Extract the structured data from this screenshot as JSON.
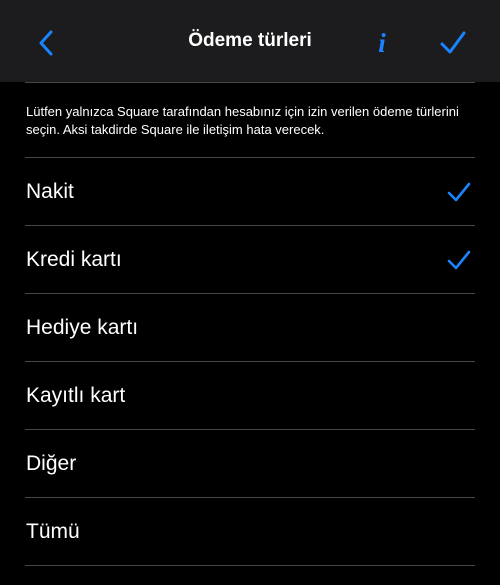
{
  "nav": {
    "title": "Ödeme türleri",
    "back_icon": "chevron-left-icon",
    "info_glyph": "i",
    "info_icon": "info-icon",
    "done_icon": "checkmark-icon"
  },
  "description": "Lütfen yalnızca Square tarafından hesabınız için izin verilen ödeme türlerini seçin. Aksi takdirde Square ile iletişim hata verecek.",
  "options": [
    {
      "label": "Nakit",
      "selected": true
    },
    {
      "label": "Kredi kartı",
      "selected": true
    },
    {
      "label": "Hediye kartı",
      "selected": false
    },
    {
      "label": "Kayıtlı kart",
      "selected": false
    },
    {
      "label": "Diğer",
      "selected": false
    },
    {
      "label": "Tümü",
      "selected": false
    }
  ],
  "colors": {
    "background": "#000000",
    "navbar": "#1c1c1e",
    "accent": "#1a84ff",
    "separator": "#48484a",
    "text": "#ffffff"
  }
}
